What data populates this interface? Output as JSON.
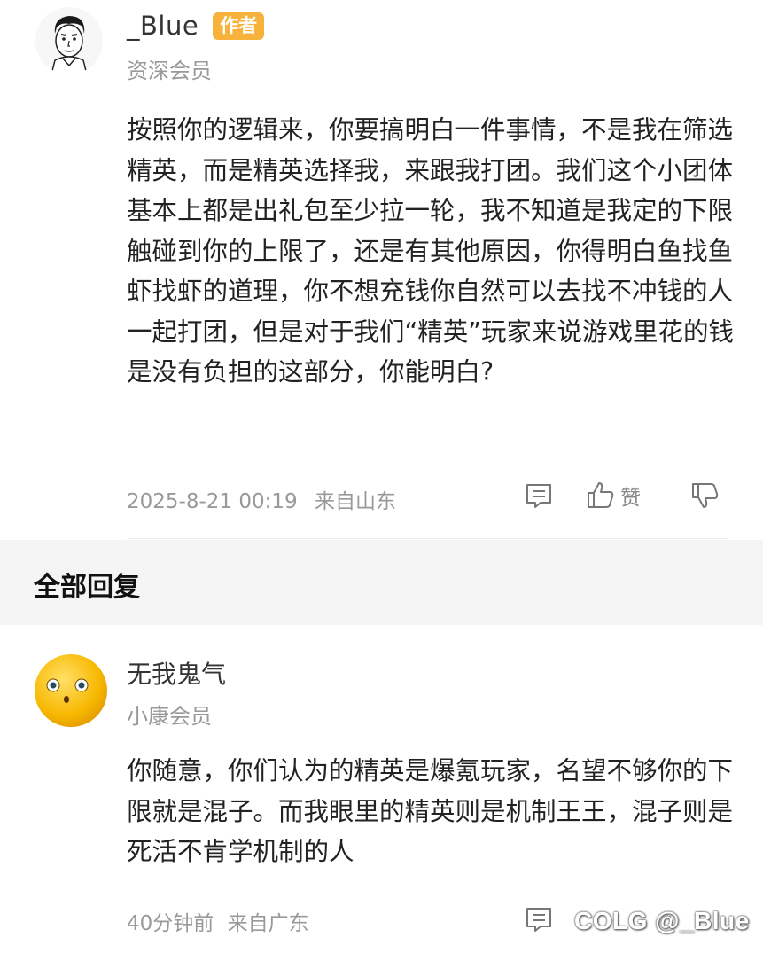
{
  "post": {
    "username": "_Blue",
    "author_badge": "作者",
    "member_level": "资深会员",
    "body": "按照你的逻辑来，你要搞明白一件事情，不是我在筛选精英，而是精英选择我，来跟我打团。我们这个小团体基本上都是出礼包至少拉一轮，我不知道是我定的下限触碰到你的上限了，还是有其他原因，你得明白鱼找鱼虾找虾的道理，你不想充钱你自然可以去找不冲钱的人一起打团，但是对于我们“精英”玩家来说游戏里花的钱是没有负担的这部分，你能明白?",
    "timestamp": "2025-8-21 00:19",
    "location": "来自山东",
    "like_label": "赞",
    "icons": [
      "comment-icon",
      "thumbs-up-icon",
      "thumbs-down-icon"
    ]
  },
  "section": {
    "title": "全部回复"
  },
  "reply": {
    "username": "无我鬼气",
    "member_level": "小康会员",
    "body": "你随意，你们认为的精英是爆氪玩家，名望不够你的下限就是混子。而我眼里的精英则是机制王王，混子则是死活不肯学机制的人",
    "timestamp": "40分钟前",
    "location": "来自广东",
    "icons": [
      "comment-icon"
    ]
  },
  "watermark": "COLG @_Blue",
  "colors": {
    "badge": "#f7b23b",
    "section_bg": "#f5f5f5",
    "meta_text": "#999999"
  }
}
